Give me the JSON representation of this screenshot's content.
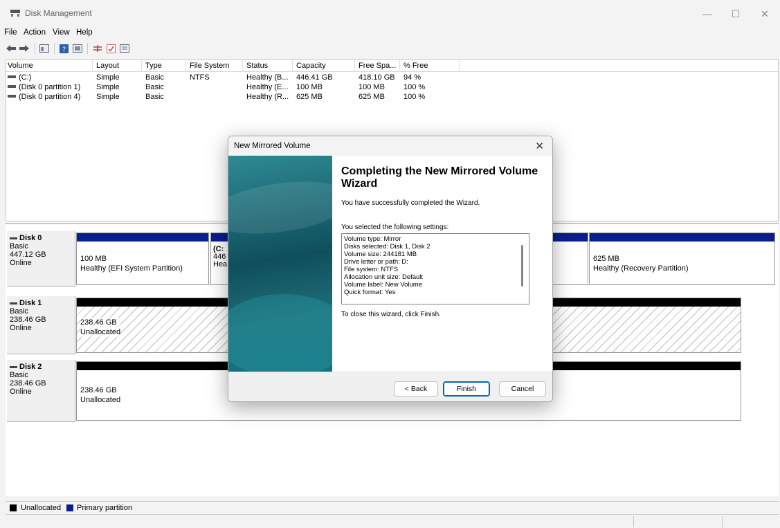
{
  "window": {
    "title": "Disk Management",
    "minimize": "—",
    "maximize": "☐",
    "close": "✕"
  },
  "menu": [
    "File",
    "Action",
    "View",
    "Help"
  ],
  "volume_list": {
    "columns": [
      "Volume",
      "Layout",
      "Type",
      "File System",
      "Status",
      "Capacity",
      "Free Spa...",
      "% Free"
    ],
    "rows": [
      [
        "(C:)",
        "Simple",
        "Basic",
        "NTFS",
        "Healthy (B...",
        "446.41 GB",
        "418.10 GB",
        "94 %"
      ],
      [
        "(Disk 0 partition 1)",
        "Simple",
        "Basic",
        "",
        "Healthy (E...",
        "100 MB",
        "100 MB",
        "100 %"
      ],
      [
        "(Disk 0 partition 4)",
        "Simple",
        "Basic",
        "",
        "Healthy (R...",
        "625 MB",
        "625 MB",
        "100 %"
      ]
    ]
  },
  "disks": [
    {
      "name": "Disk 0",
      "type": "Basic",
      "size": "447.12 GB",
      "state": "Online",
      "partitions": [
        {
          "size": "100 MB",
          "status": "Healthy (EFI System Partition)"
        },
        {
          "name": "(C:",
          "size": "446",
          "status": "Hea"
        },
        {
          "size": "625 MB",
          "status": "Healthy (Recovery Partition)"
        }
      ]
    },
    {
      "name": "Disk 1",
      "type": "Basic",
      "size": "238.46 GB",
      "state": "Online",
      "partitions": [
        {
          "size": "238.46 GB",
          "status": "Unallocated"
        }
      ]
    },
    {
      "name": "Disk 2",
      "type": "Basic",
      "size": "238.46 GB",
      "state": "Online",
      "partitions": [
        {
          "size": "238.46 GB",
          "status": "Unallocated"
        }
      ]
    }
  ],
  "legend": [
    {
      "label": "Unallocated",
      "color": "#000000"
    },
    {
      "label": "Primary partition",
      "color": "#0a1e8c"
    }
  ],
  "dialog": {
    "title": "New Mirrored Volume",
    "close": "✕",
    "heading": "Completing the New Mirrored Volume Wizard",
    "success": "You have successfully completed the Wizard.",
    "settings_intro": "You selected the following settings:",
    "settings": [
      "Volume type: Mirror",
      "Disks selected: Disk 1, Disk 2",
      "Volume size: 244181 MB",
      "Drive letter or path: D:",
      "File system: NTFS",
      "Allocation unit size: Default",
      "Volume label: New Volume",
      "Quick format: Yes"
    ],
    "close_hint": "To close this wizard, click Finish.",
    "buttons": {
      "back": "< Back",
      "finish": "Finish",
      "cancel": "Cancel"
    }
  }
}
